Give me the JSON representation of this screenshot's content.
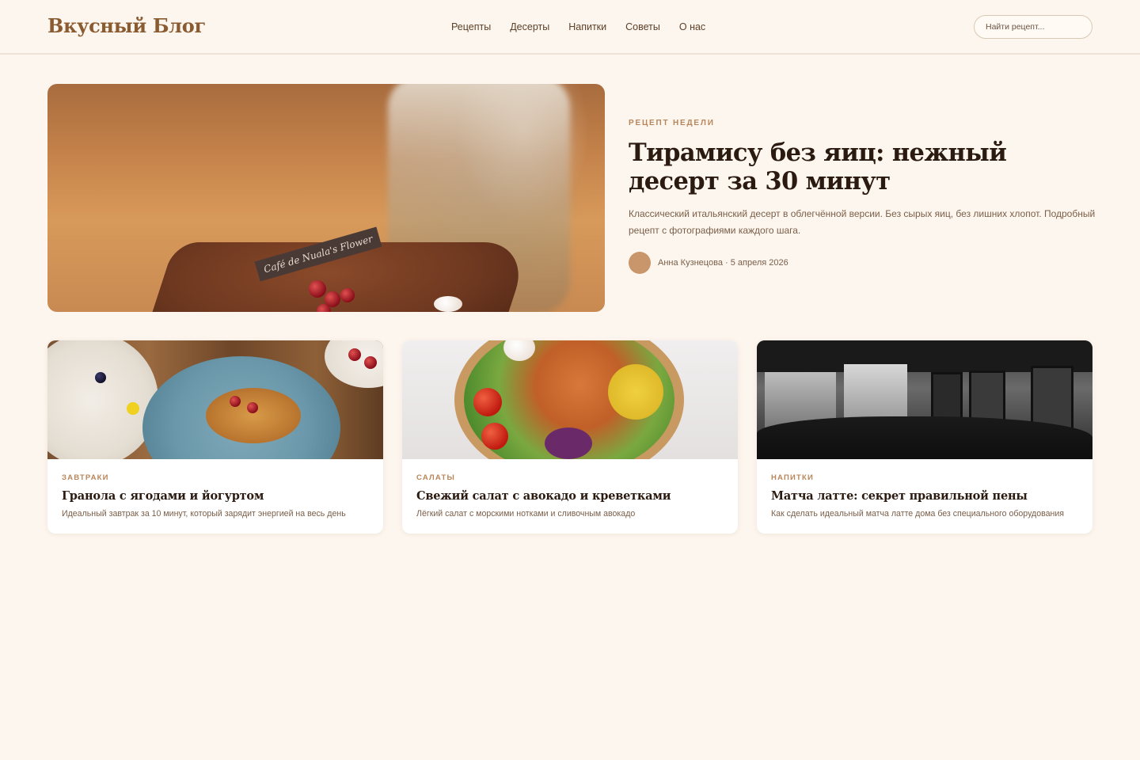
{
  "header": {
    "logo": "Вкусный Блог",
    "nav": [
      "Рецепты",
      "Десерты",
      "Напитки",
      "Советы",
      "О нас"
    ],
    "search_placeholder": "Найти рецепт..."
  },
  "hero": {
    "kicker": "РЕЦЕПТ НЕДЕЛИ",
    "title": "Тирамису без яиц: нежный десерт за 30 минут",
    "description": "Классический итальянский десерт в облегчённой версии. Без сырых яиц, без лишних хлопот. Подробный рецепт с фотографиями каждого шага.",
    "author_line": "Анна Кузнецова · 5 апреля 2026",
    "image_tag": "Café de Nuala's Flower"
  },
  "cards": [
    {
      "category": "ЗАВТРАКИ",
      "title": "Гранола с ягодами и йогуртом",
      "description": "Идеальный завтрак за 10 минут, который зарядит энергией на весь день"
    },
    {
      "category": "САЛАТЫ",
      "title": "Свежий салат с авокадо и креветками",
      "description": "Лёгкий салат с морскими нотками и сливочным авокадо"
    },
    {
      "category": "НАПИТКИ",
      "title": "Матча латте: секрет правильной пены",
      "description": "Как сделать идеальный матча латте дома без специального оборудования"
    }
  ],
  "colors": {
    "background": "#fdf6ee",
    "accent": "#b8865a",
    "logo": "#8a5a30",
    "heading": "#2a1a10",
    "avatar": "#c9956a"
  }
}
